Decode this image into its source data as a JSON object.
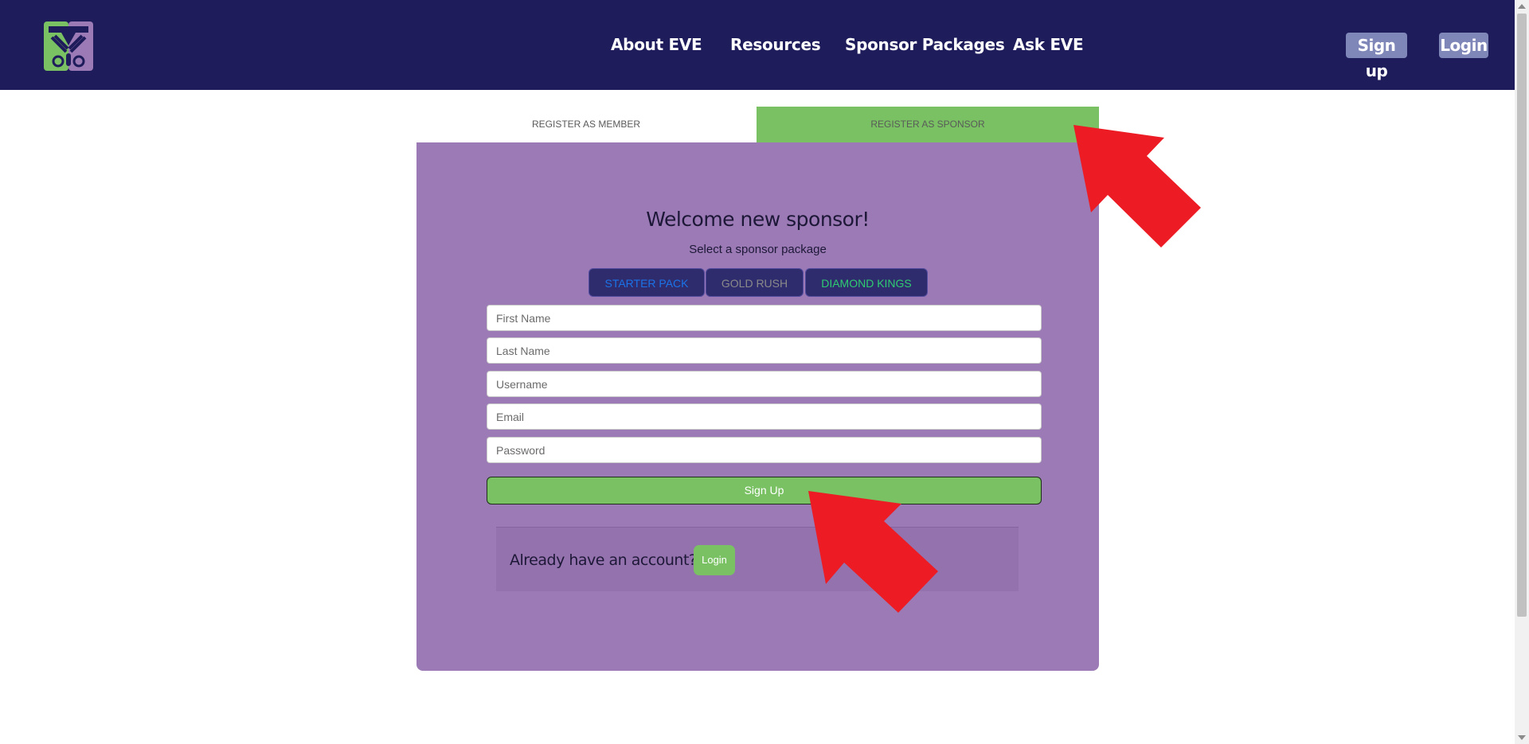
{
  "header": {
    "nav": [
      {
        "label": "About EVE"
      },
      {
        "label": "Resources"
      },
      {
        "label": "Sponsor Packages"
      },
      {
        "label": "Ask EVE"
      }
    ],
    "signup_label": "Sign up",
    "login_label": "Login"
  },
  "tabs": {
    "member": "REGISTER AS MEMBER",
    "sponsor": "REGISTER AS SPONSOR",
    "active": "sponsor"
  },
  "form": {
    "title": "Welcome new sponsor!",
    "subtitle": "Select a sponsor package",
    "packages": [
      {
        "label": "STARTER PACK",
        "color": "#1a73e8"
      },
      {
        "label": "GOLD RUSH",
        "color": "#8a8a8a"
      },
      {
        "label": "DIAMOND KINGS",
        "color": "#2ecc71"
      }
    ],
    "fields": {
      "first_name": "First Name",
      "last_name": "Last Name",
      "username": "Username",
      "email": "Email",
      "password": "Password"
    },
    "submit_label": "Sign Up",
    "already_text": "Already have an account?",
    "already_login_label": "Login"
  },
  "colors": {
    "header_bg": "#1f1c5c",
    "card_bg": "#9b7ab5",
    "accent_green": "#79c163",
    "annotation_arrow": "#ed1c24"
  }
}
